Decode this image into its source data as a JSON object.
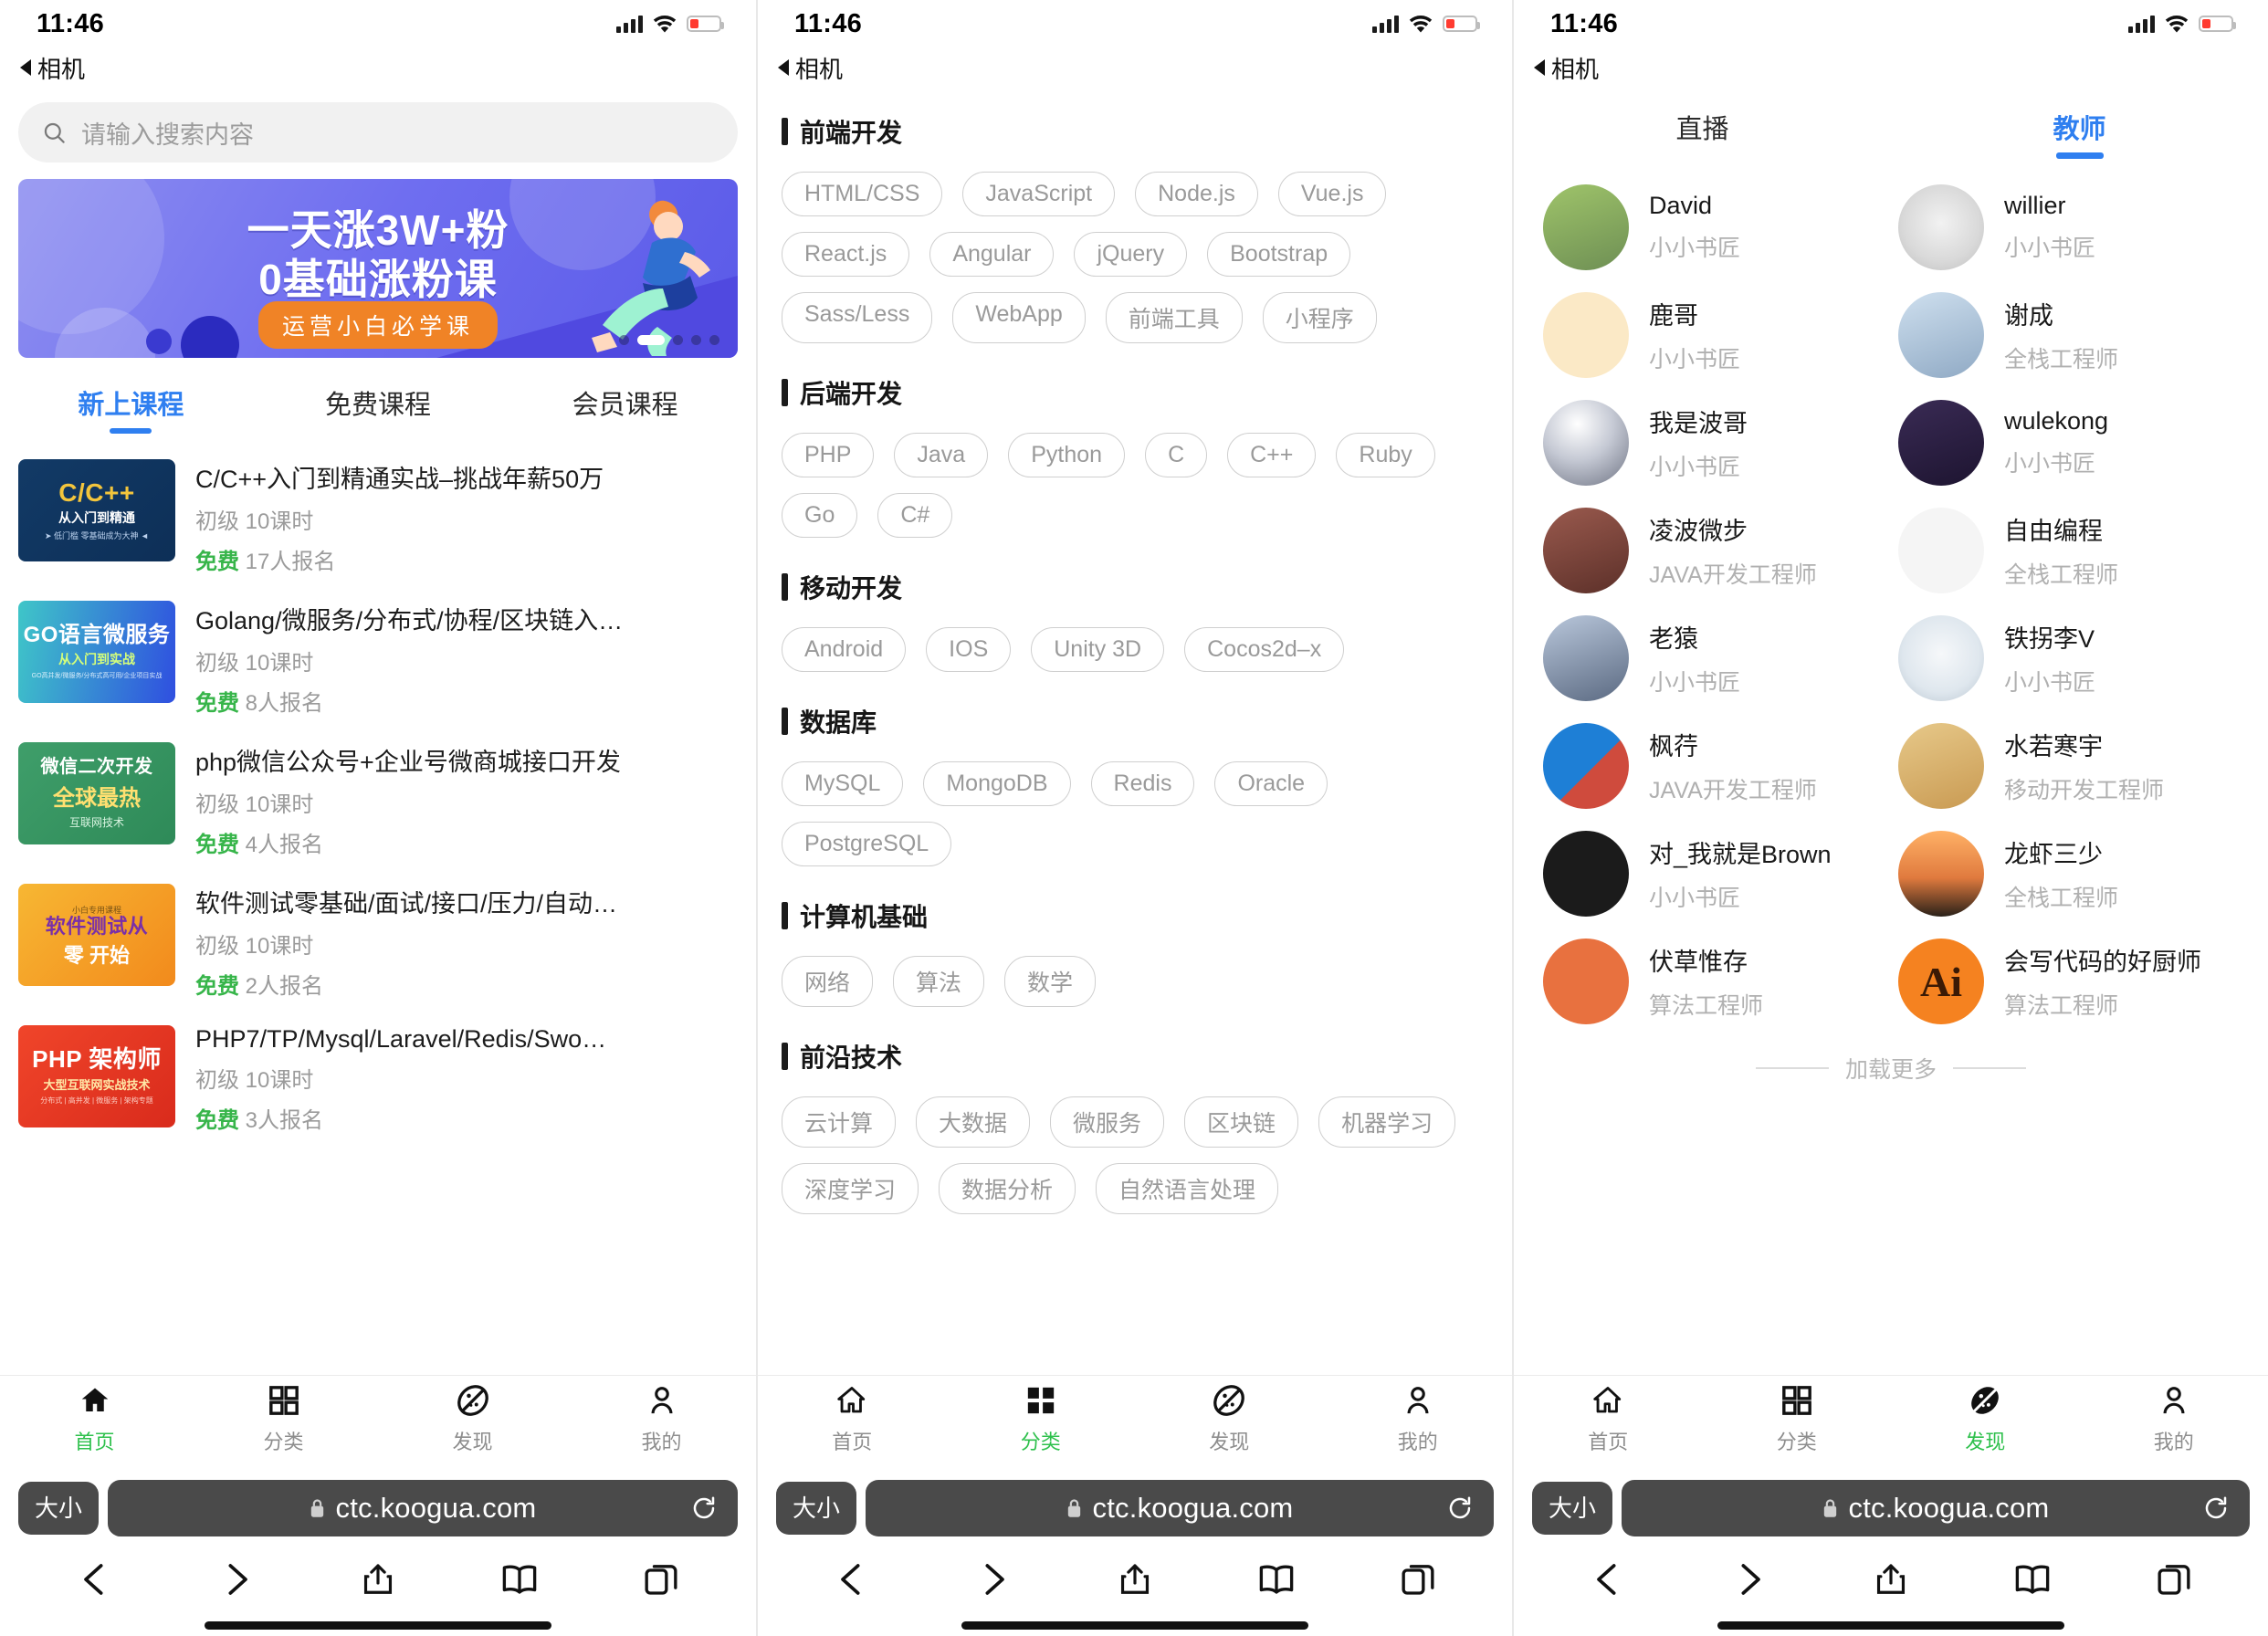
{
  "status_bar": {
    "time": "11:46",
    "back_app_label": "相机"
  },
  "browser": {
    "size_button": "大小",
    "url": "ctc.koogua.com",
    "back_icon": "chevron-left-icon",
    "forward_icon": "chevron-right-icon",
    "share_icon": "share-icon",
    "bookmarks_icon": "book-icon",
    "tabs_icon": "tabs-icon",
    "reload_icon": "reload-icon",
    "lock_icon": "lock-icon"
  },
  "app_nav": {
    "items": [
      {
        "label": "首页",
        "icon": "home-icon"
      },
      {
        "label": "分类",
        "icon": "grid-icon"
      },
      {
        "label": "发现",
        "icon": "compass-icon"
      },
      {
        "label": "我的",
        "icon": "person-icon"
      }
    ],
    "active_index_home": 0,
    "active_index_category": 1,
    "active_index_discover": 2,
    "active_color": "#2ec04c"
  },
  "home": {
    "search": {
      "placeholder": "请输入搜索内容",
      "icon": "search-icon"
    },
    "banner": {
      "line1": "一天涨3W+粉",
      "line2": "0基础涨粉课",
      "badge": "运营小白必学课",
      "dots_total": 5,
      "dots_active_index": 1
    },
    "tabs": [
      {
        "label": "新上课程",
        "active": true
      },
      {
        "label": "免费课程",
        "active": false
      },
      {
        "label": "会员课程",
        "active": false
      }
    ],
    "courses": [
      {
        "title": "C/C++入门到精通实战–挑战年薪50万",
        "level": "初级",
        "lessons": "10课时",
        "price": "免费",
        "enrolled": "17人报名",
        "thumb": {
          "style": "th-cpp",
          "l1": "C/C++",
          "l2": "从入门到精通",
          "l3": "➤ 低门槛 零基础成为大神 ◄"
        }
      },
      {
        "title": "Golang/微服务/分布式/协程/区块链入…",
        "level": "初级",
        "lessons": "10课时",
        "price": "免费",
        "enrolled": "8人报名",
        "thumb": {
          "style": "th-go",
          "l1": "GO语言微服务",
          "l2": "从入门到实战",
          "l3": "GO高并发/微服务/分布式高可用/企业项目实战"
        }
      },
      {
        "title": "php微信公众号+企业号微商城接口开发",
        "level": "初级",
        "lessons": "10课时",
        "price": "免费",
        "enrolled": "4人报名",
        "thumb": {
          "style": "th-wx",
          "l1": "微信二次开发",
          "l2": "全球最热",
          "l3": "互联网技术"
        }
      },
      {
        "title": "软件测试零基础/面试/接口/压力/自动…",
        "level": "初级",
        "lessons": "10课时",
        "price": "免费",
        "enrolled": "2人报名",
        "thumb": {
          "style": "th-test",
          "l1": "软件测试从",
          "l2": "零 开始",
          "l3": "小白专用课程"
        }
      },
      {
        "title": "PHP7/TP/Mysql/Laravel/Redis/Swo…",
        "level": "初级",
        "lessons": "10课时",
        "price": "免费",
        "enrolled": "3人报名",
        "thumb": {
          "style": "th-php",
          "l1": "PHP 架构师",
          "l2": "大型互联网实战技术",
          "l3": "分布式 | 高并发 | 微服务 | 架构专题"
        }
      }
    ]
  },
  "category": {
    "sections": [
      {
        "title": "前端开发",
        "tags": [
          "HTML/CSS",
          "JavaScript",
          "Node.js",
          "Vue.js",
          "React.js",
          "Angular",
          "jQuery",
          "Bootstrap",
          "Sass/Less",
          "WebApp",
          "前端工具",
          "小程序"
        ]
      },
      {
        "title": "后端开发",
        "tags": [
          "PHP",
          "Java",
          "Python",
          "C",
          "C++",
          "Ruby",
          "Go",
          "C#"
        ]
      },
      {
        "title": "移动开发",
        "tags": [
          "Android",
          "IOS",
          "Unity 3D",
          "Cocos2d–x"
        ]
      },
      {
        "title": "数据库",
        "tags": [
          "MySQL",
          "MongoDB",
          "Redis",
          "Oracle",
          "PostgreSQL"
        ]
      },
      {
        "title": "计算机基础",
        "tags": [
          "网络",
          "算法",
          "数学"
        ]
      },
      {
        "title": "前沿技术",
        "tags": [
          "云计算",
          "大数据",
          "微服务",
          "区块链",
          "机器学习",
          "深度学习",
          "数据分析",
          "自然语言处理"
        ]
      }
    ]
  },
  "discover": {
    "tabs": [
      {
        "label": "直播",
        "active": false
      },
      {
        "label": "教师",
        "active": true
      }
    ],
    "teachers": [
      {
        "name": "David",
        "role": "小小书匠",
        "avatar_class": "av1",
        "avatar_text": ""
      },
      {
        "name": "willier",
        "role": "小小书匠",
        "avatar_class": "av2",
        "avatar_text": ""
      },
      {
        "name": "鹿哥",
        "role": "小小书匠",
        "avatar_class": "av3",
        "avatar_text": ""
      },
      {
        "name": "谢成",
        "role": "全栈工程师",
        "avatar_class": "av4",
        "avatar_text": ""
      },
      {
        "name": "我是波哥",
        "role": "小小书匠",
        "avatar_class": "av5",
        "avatar_text": ""
      },
      {
        "name": "wulekong",
        "role": "小小书匠",
        "avatar_class": "av6",
        "avatar_text": ""
      },
      {
        "name": "凌波微步",
        "role": "JAVA开发工程师",
        "avatar_class": "av7",
        "avatar_text": ""
      },
      {
        "name": "自由编程",
        "role": "全栈工程师",
        "avatar_class": "av8",
        "avatar_text": ""
      },
      {
        "name": "老猿",
        "role": "小小书匠",
        "avatar_class": "av9",
        "avatar_text": ""
      },
      {
        "name": "铁拐李V",
        "role": "小小书匠",
        "avatar_class": "av10",
        "avatar_text": ""
      },
      {
        "name": "枫荇",
        "role": "JAVA开发工程师",
        "avatar_class": "av11",
        "avatar_text": ""
      },
      {
        "name": "水若寒宇",
        "role": "移动开发工程师",
        "avatar_class": "av12",
        "avatar_text": ""
      },
      {
        "name": "对_我就是Brown",
        "role": "小小书匠",
        "avatar_class": "av13",
        "avatar_text": ""
      },
      {
        "name": "龙虾三少",
        "role": "全栈工程师",
        "avatar_class": "av14",
        "avatar_text": ""
      },
      {
        "name": "伏草惟存",
        "role": "算法工程师",
        "avatar_class": "av15",
        "avatar_text": ""
      },
      {
        "name": "会写代码的好厨师",
        "role": "算法工程师",
        "avatar_class": "av16",
        "avatar_text": "Ai"
      }
    ],
    "load_more": "加载更多"
  }
}
